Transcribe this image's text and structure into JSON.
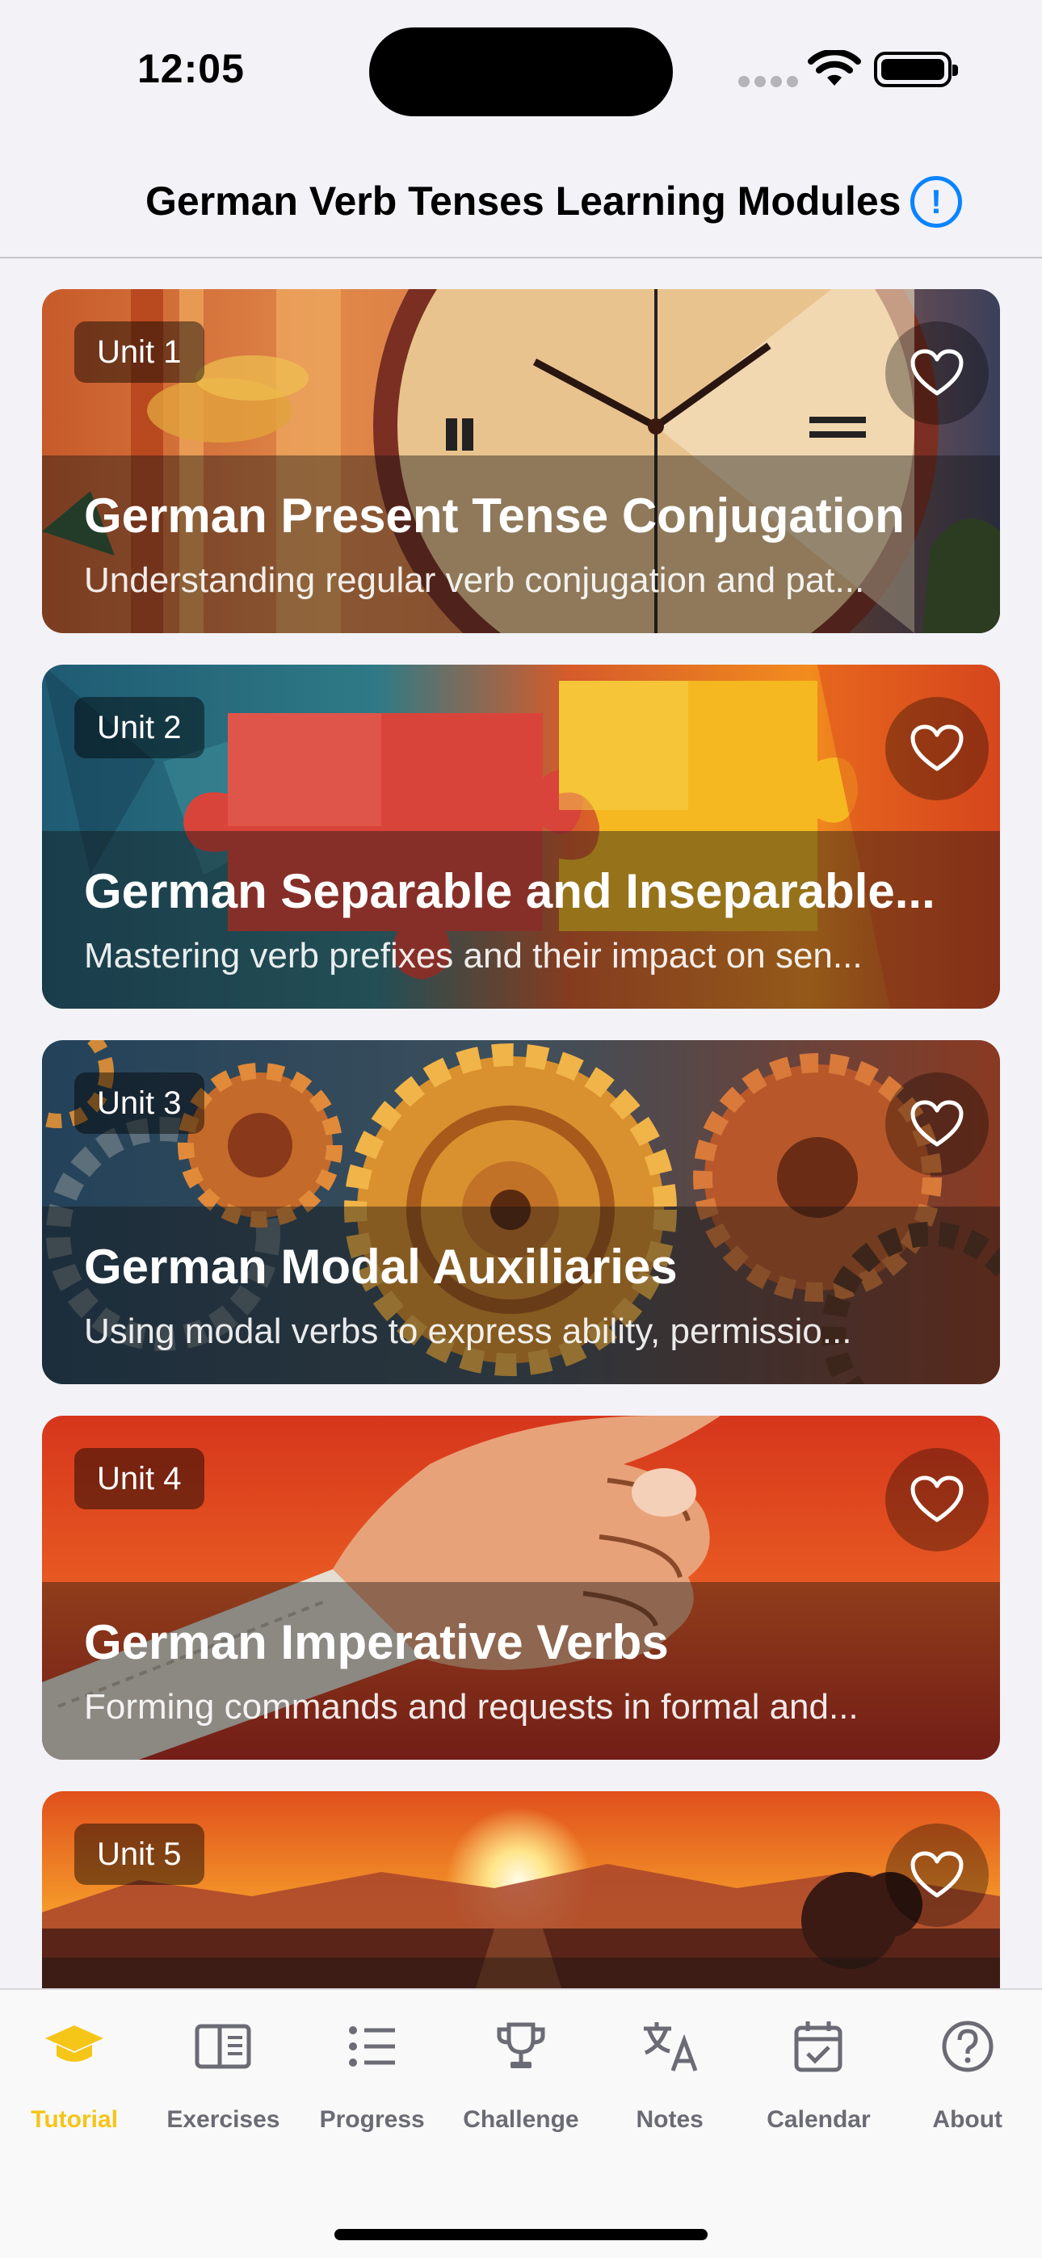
{
  "status_bar": {
    "time": "12:05"
  },
  "header": {
    "title": "German Verb Tenses Learning Modules",
    "info_icon": "info-circle-icon",
    "accent": "#0a84ff"
  },
  "cards": [
    {
      "unit": "Unit 1",
      "title": "German Present Tense Conjugation",
      "subtitle": "Understanding regular verb conjugation and pat...",
      "favorite_icon": "heart-outline-icon",
      "favorited": false
    },
    {
      "unit": "Unit 2",
      "title": "German Separable and Inseparable...",
      "subtitle": "Mastering verb prefixes and their impact on sen...",
      "favorite_icon": "heart-outline-icon",
      "favorited": false
    },
    {
      "unit": "Unit 3",
      "title": "German Modal Auxiliaries",
      "subtitle": "Using modal verbs to express ability, permissio...",
      "favorite_icon": "heart-outline-icon",
      "favorited": false
    },
    {
      "unit": "Unit 4",
      "title": "German Imperative Verbs",
      "subtitle": "Forming commands and requests in formal and...",
      "favorite_icon": "heart-outline-icon",
      "favorited": false
    },
    {
      "unit": "Unit 5",
      "favorite_icon": "heart-outline-icon",
      "favorited": false
    }
  ],
  "tab_bar": {
    "active_color": "#f5c518",
    "inactive_color": "#6b6b75",
    "tabs": [
      {
        "label": "Tutorial",
        "icon": "graduation-cap-icon",
        "active": true
      },
      {
        "label": "Exercises",
        "icon": "book-icon",
        "active": false
      },
      {
        "label": "Progress",
        "icon": "list-icon",
        "active": false
      },
      {
        "label": "Challenge",
        "icon": "trophy-icon",
        "active": false
      },
      {
        "label": "Notes",
        "icon": "translate-icon",
        "active": false
      },
      {
        "label": "Calendar",
        "icon": "calendar-check-icon",
        "active": false
      },
      {
        "label": "About",
        "icon": "question-circle-icon",
        "active": false
      }
    ]
  }
}
